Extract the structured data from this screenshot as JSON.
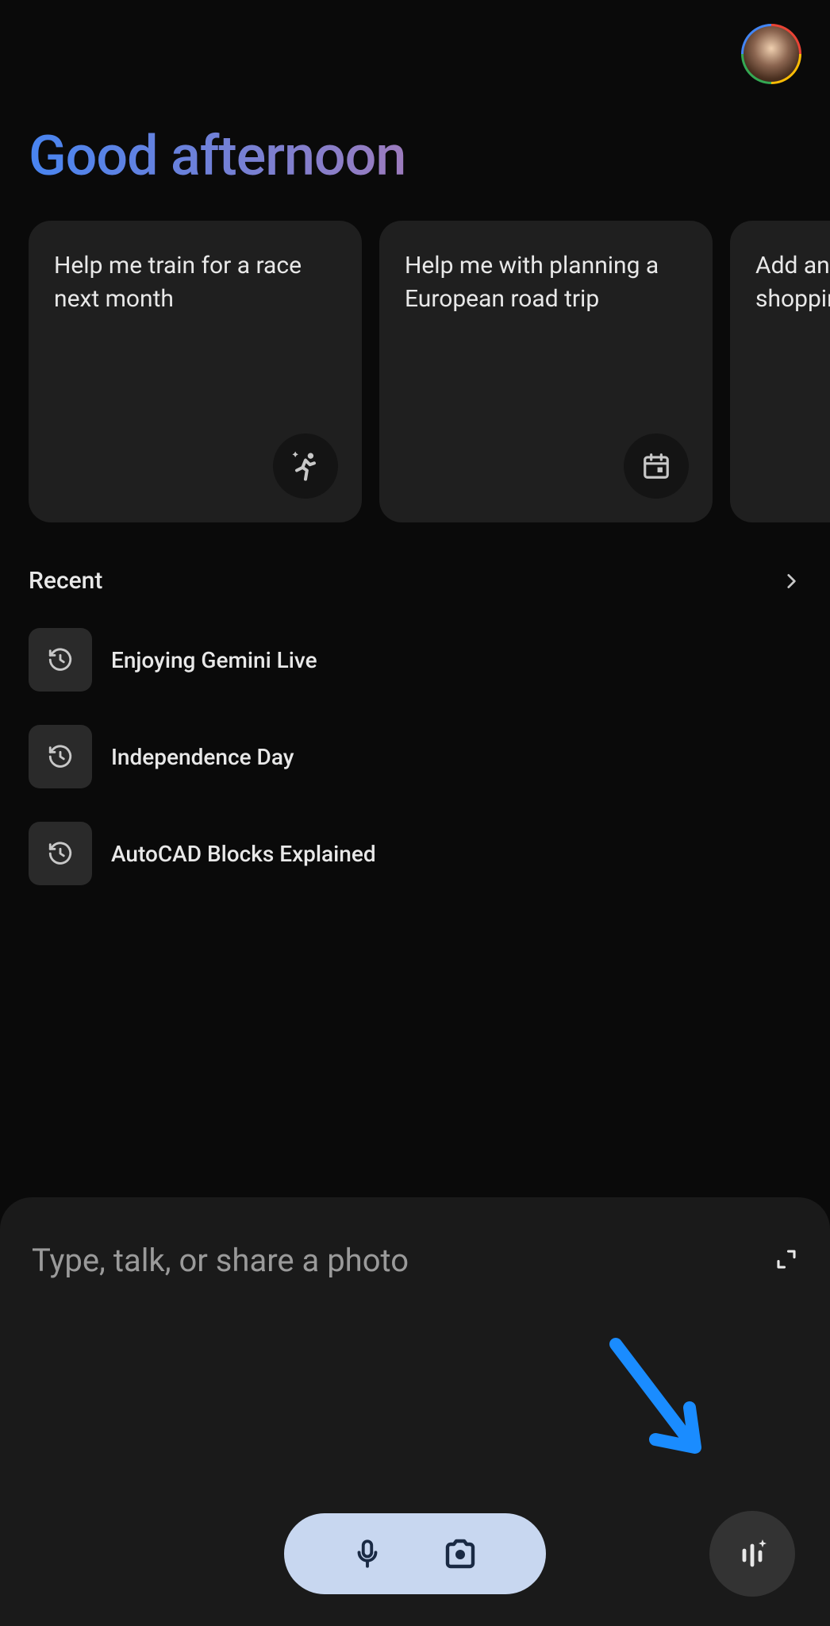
{
  "greeting": "Good afternoon",
  "suggestion_cards": [
    {
      "text": "Help me train for a race next month",
      "icon": "running-sparkle"
    },
    {
      "text": "Help me with planning a European road trip",
      "icon": "calendar"
    },
    {
      "text": "Add an item to my shopping list",
      "icon": "list"
    }
  ],
  "recent": {
    "title": "Recent",
    "items": [
      "Enjoying Gemini Live",
      "Independence Day",
      "AutoCAD Blocks Explained"
    ]
  },
  "input": {
    "placeholder": "Type, talk, or share a photo"
  },
  "colors": {
    "annotation_arrow": "#1a8cff"
  }
}
